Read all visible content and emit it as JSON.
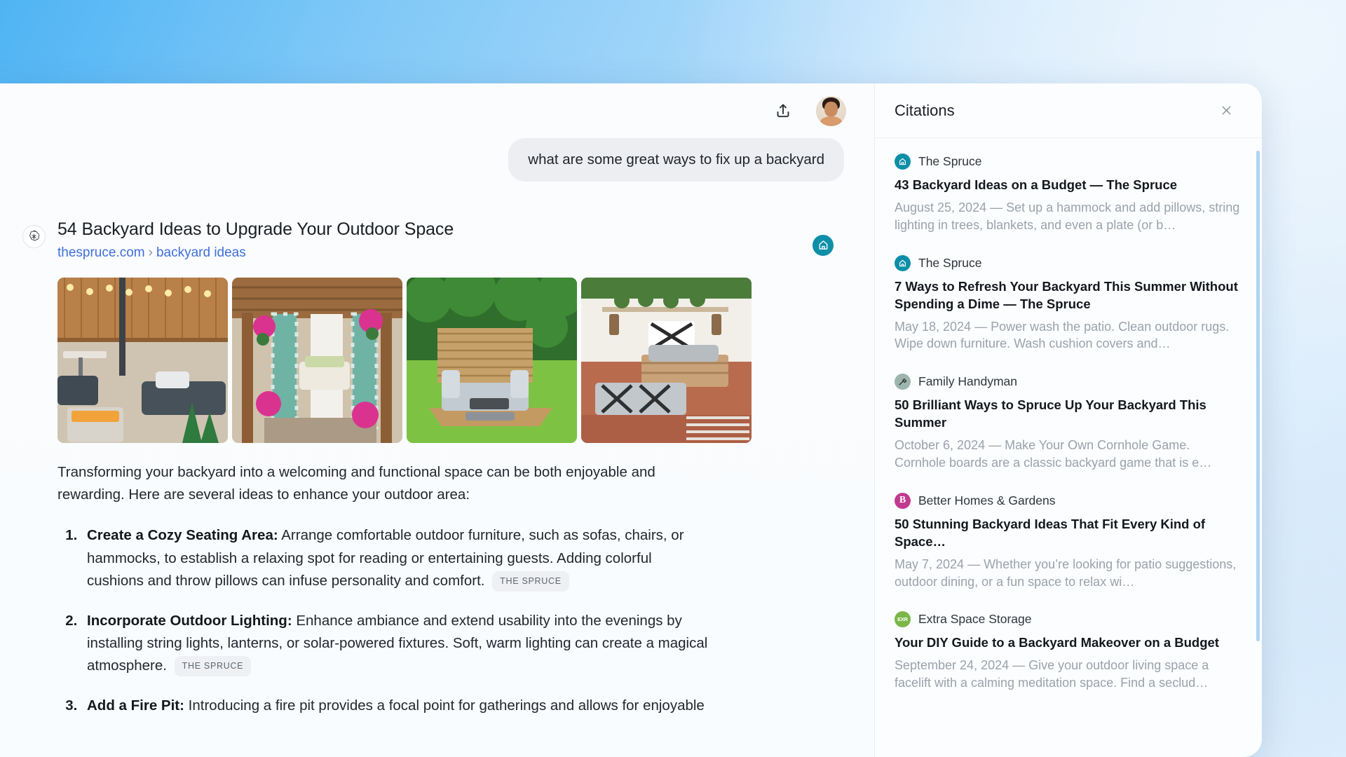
{
  "window": {
    "background_accent": "#4fb4f4"
  },
  "topbar": {
    "share_icon": "share-upload-icon",
    "avatar_icon": "user-avatar"
  },
  "conversation": {
    "user_message": "what are some great ways to fix up a backyard",
    "assistant_avatar_icon": "openai-logo-icon"
  },
  "search_result": {
    "title": "54 Backyard Ideas to Upgrade Your Outdoor Space",
    "domain": "thespruce.com",
    "breadcrumb_separator": "›",
    "path": "backyard ideas",
    "favicon_name": "the-spruce-house-icon",
    "favicon_color": "#0e8fa8",
    "thumbnails": [
      {
        "name": "backyard-firepit-string-lights-thumbnail",
        "alt": "Backyard with fire pit, string lights and gray patio furniture"
      },
      {
        "name": "pergola-swing-flowers-thumbnail",
        "alt": "Wooden pergola with curtains, swing bench and pink flowers"
      },
      {
        "name": "garden-corner-sofa-deck-thumbnail",
        "alt": "Green lawn with corner sofa on a wooden deck"
      },
      {
        "name": "pallet-lounge-lanterns-thumbnail",
        "alt": "Pallet lounge seating with patterned cushions and lanterns"
      }
    ]
  },
  "answer": {
    "intro": "Transforming your backyard into a welcoming and functional space can be both enjoyable and rewarding. Here are several ideas to enhance your outdoor area:",
    "items": [
      {
        "heading": "Create a Cozy Seating Area:",
        "body": "Arrange comfortable outdoor furniture, such as sofas, chairs, or hammocks, to establish a relaxing spot for reading or entertaining guests. Adding colorful cushions and throw pillows can infuse personality and comfort.",
        "citation": "THE SPRUCE"
      },
      {
        "heading": "Incorporate Outdoor Lighting:",
        "body": "Enhance ambiance and extend usability into the evenings by installing string lights, lanterns, or solar-powered fixtures. Soft, warm lighting can create a magical atmosphere.",
        "citation": "THE SPRUCE"
      },
      {
        "heading": "Add a Fire Pit:",
        "body": "Introducing a fire pit provides a focal point for gatherings and allows for enjoyable",
        "citation": ""
      }
    ]
  },
  "citations_panel": {
    "title": "Citations",
    "close_icon": "close-x-icon",
    "items": [
      {
        "source": "The Spruce",
        "logo_name": "the-spruce-house-icon",
        "logo_color": "#0e8fa8",
        "headline": "43 Backyard Ideas on a Budget — The Spruce",
        "snippet": "August 25, 2024 — Set up a hammock and add pillows, string lighting in trees, blankets, and even a plate (or b…"
      },
      {
        "source": "The Spruce",
        "logo_name": "the-spruce-house-icon",
        "logo_color": "#0e8fa8",
        "headline": "7 Ways to Refresh Your Backyard This Summer Without Spending a Dime — The Spruce",
        "snippet": "May 18, 2024 — Power wash the patio. Clean outdoor rugs. Wipe down furniture. Wash cushion covers and…"
      },
      {
        "source": "Family Handyman",
        "logo_name": "family-handyman-hammer-icon",
        "logo_color": "#9db5ad",
        "headline": "50 Brilliant Ways to Spruce Up Your Backyard This Summer",
        "snippet": "October 6, 2024 — Make Your Own Cornhole Game. Cornhole boards are a classic backyard game that is e…"
      },
      {
        "source": "Better Homes & Gardens",
        "logo_name": "better-homes-gardens-b-icon",
        "logo_color": "#c23a90",
        "headline": "50 Stunning Backyard Ideas That Fit Every Kind of Space…",
        "snippet": "May 7, 2024 — Whether you’re looking for patio suggestions, outdoor dining, or a fun space to relax wi…"
      },
      {
        "source": "Extra Space Storage",
        "logo_name": "extra-space-storage-exr-icon",
        "logo_color": "#7ab648",
        "headline": "Your DIY Guide to a Backyard Makeover on a Budget",
        "snippet": "September 24, 2024 — Give your outdoor living space a facelift with a calming meditation space. Find a seclud…"
      }
    ]
  }
}
